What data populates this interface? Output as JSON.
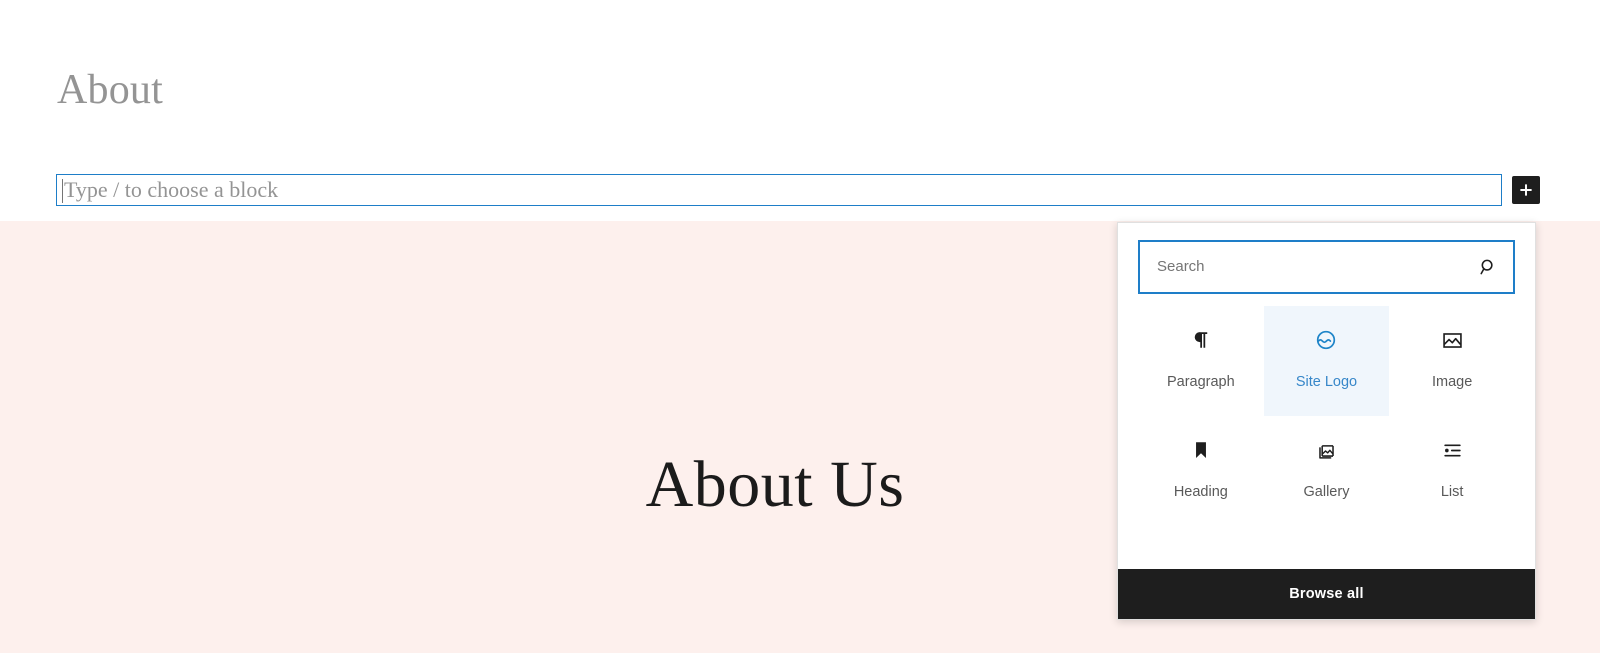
{
  "editor": {
    "page_title": "About",
    "empty_block_placeholder": "Type / to choose a block",
    "inserter_toggle_label": "Add block"
  },
  "content": {
    "heading": "About Us",
    "background_color": "#fdf0ed"
  },
  "quick_inserter": {
    "search_placeholder": "Search",
    "search_icon": "search-icon",
    "blocks": [
      {
        "label": "Paragraph",
        "icon": "paragraph-icon",
        "selected": false
      },
      {
        "label": "Site Logo",
        "icon": "site-logo-icon",
        "selected": true
      },
      {
        "label": "Image",
        "icon": "image-icon",
        "selected": false
      },
      {
        "label": "Heading",
        "icon": "heading-icon",
        "selected": false
      },
      {
        "label": "Gallery",
        "icon": "gallery-icon",
        "selected": false
      },
      {
        "label": "List",
        "icon": "list-icon",
        "selected": false
      }
    ],
    "browse_all_label": "Browse all",
    "accent_color": "#1e84c8",
    "selected_background": "#f0f6fc",
    "footer_background": "#1e1e1e"
  }
}
